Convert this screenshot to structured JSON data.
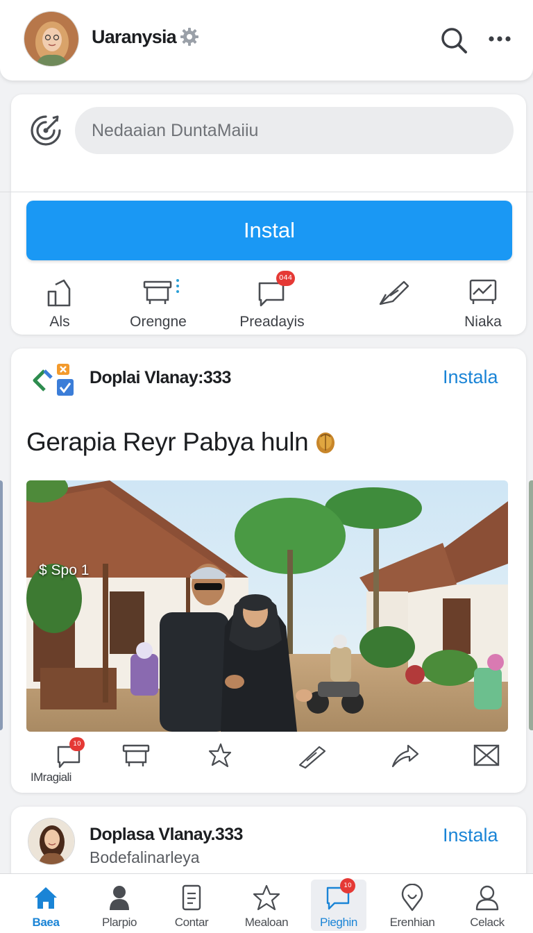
{
  "header": {
    "username": "Uaranysia",
    "search_icon": "search-icon",
    "more_icon": "more-icon"
  },
  "composer": {
    "placeholder": "Nedaaian DuntaMaiiu",
    "install_label": "Instal",
    "actions": [
      {
        "label": "Als",
        "icon": "bookmark-icon"
      },
      {
        "label": "Orengne",
        "icon": "tray-icon"
      },
      {
        "label": "Preadayis",
        "icon": "comment-icon",
        "badge": "044"
      },
      {
        "label": "",
        "icon": "pen-icon"
      },
      {
        "label": "Niaka",
        "icon": "chart-icon"
      }
    ]
  },
  "post": {
    "author": "Doplai Vlanay:333",
    "install_label": "Instala",
    "text": "Gerapia Reyr Pabya huln",
    "image_caption": "$ Spo 1",
    "actions": [
      {
        "label": "IMragiali",
        "icon": "comment-icon",
        "badge": "10"
      },
      {
        "label": "",
        "icon": "tray-icon"
      },
      {
        "label": "",
        "icon": "star-icon"
      },
      {
        "label": "",
        "icon": "pen-icon"
      },
      {
        "label": "",
        "icon": "share-icon"
      },
      {
        "label": "",
        "icon": "mail-icon"
      }
    ]
  },
  "post2": {
    "author": "Doplasa Vlanay.333",
    "subtitle": "Bodefalinarleya",
    "install_label": "Instala"
  },
  "bottom_nav": [
    {
      "label": "Baea",
      "icon": "home-icon",
      "active": true
    },
    {
      "label": "Plarpio",
      "icon": "person-icon"
    },
    {
      "label": "Contar",
      "icon": "document-icon"
    },
    {
      "label": "Mealoan",
      "icon": "star-icon"
    },
    {
      "label": "Pieghin",
      "icon": "chat-icon",
      "badge": "10"
    },
    {
      "label": "Erenhian",
      "icon": "location-icon"
    },
    {
      "label": "Celack",
      "icon": "profile-icon"
    }
  ],
  "colors": {
    "accent": "#1a98f4",
    "link": "#1a84d6",
    "badge": "#e53935",
    "background": "#f1f2f4"
  }
}
